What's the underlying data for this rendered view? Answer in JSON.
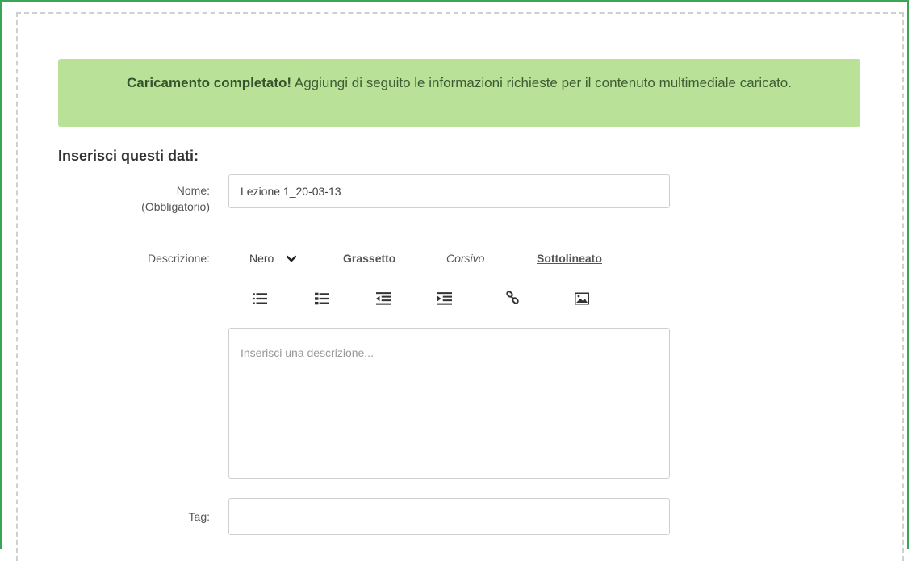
{
  "alert": {
    "strong": "Caricamento completato!",
    "text": " Aggiungi di seguito le informazioni richieste per il contenuto multimediale caricato."
  },
  "section_title": "Inserisci questi dati:",
  "fields": {
    "nome": {
      "label": "Nome:",
      "sublabel": "(Obbligatorio)",
      "value": "Lezione 1_20-03-13"
    },
    "descrizione": {
      "label": "Descrizione:",
      "placeholder": "Inserisci una descrizione..."
    },
    "tag": {
      "label": "Tag:",
      "value": ""
    }
  },
  "toolbar": {
    "color_select": "Nero",
    "bold": "Grassetto",
    "italic": "Corsivo",
    "underline": "Sottolineato",
    "icons": [
      "bulleted-list-icon",
      "numbered-list-icon",
      "outdent-icon",
      "indent-icon",
      "link-icon",
      "image-icon"
    ]
  },
  "colors": {
    "frame_border": "#3aa655",
    "alert_bg": "#b9e197",
    "alert_text": "#3f5c35"
  }
}
